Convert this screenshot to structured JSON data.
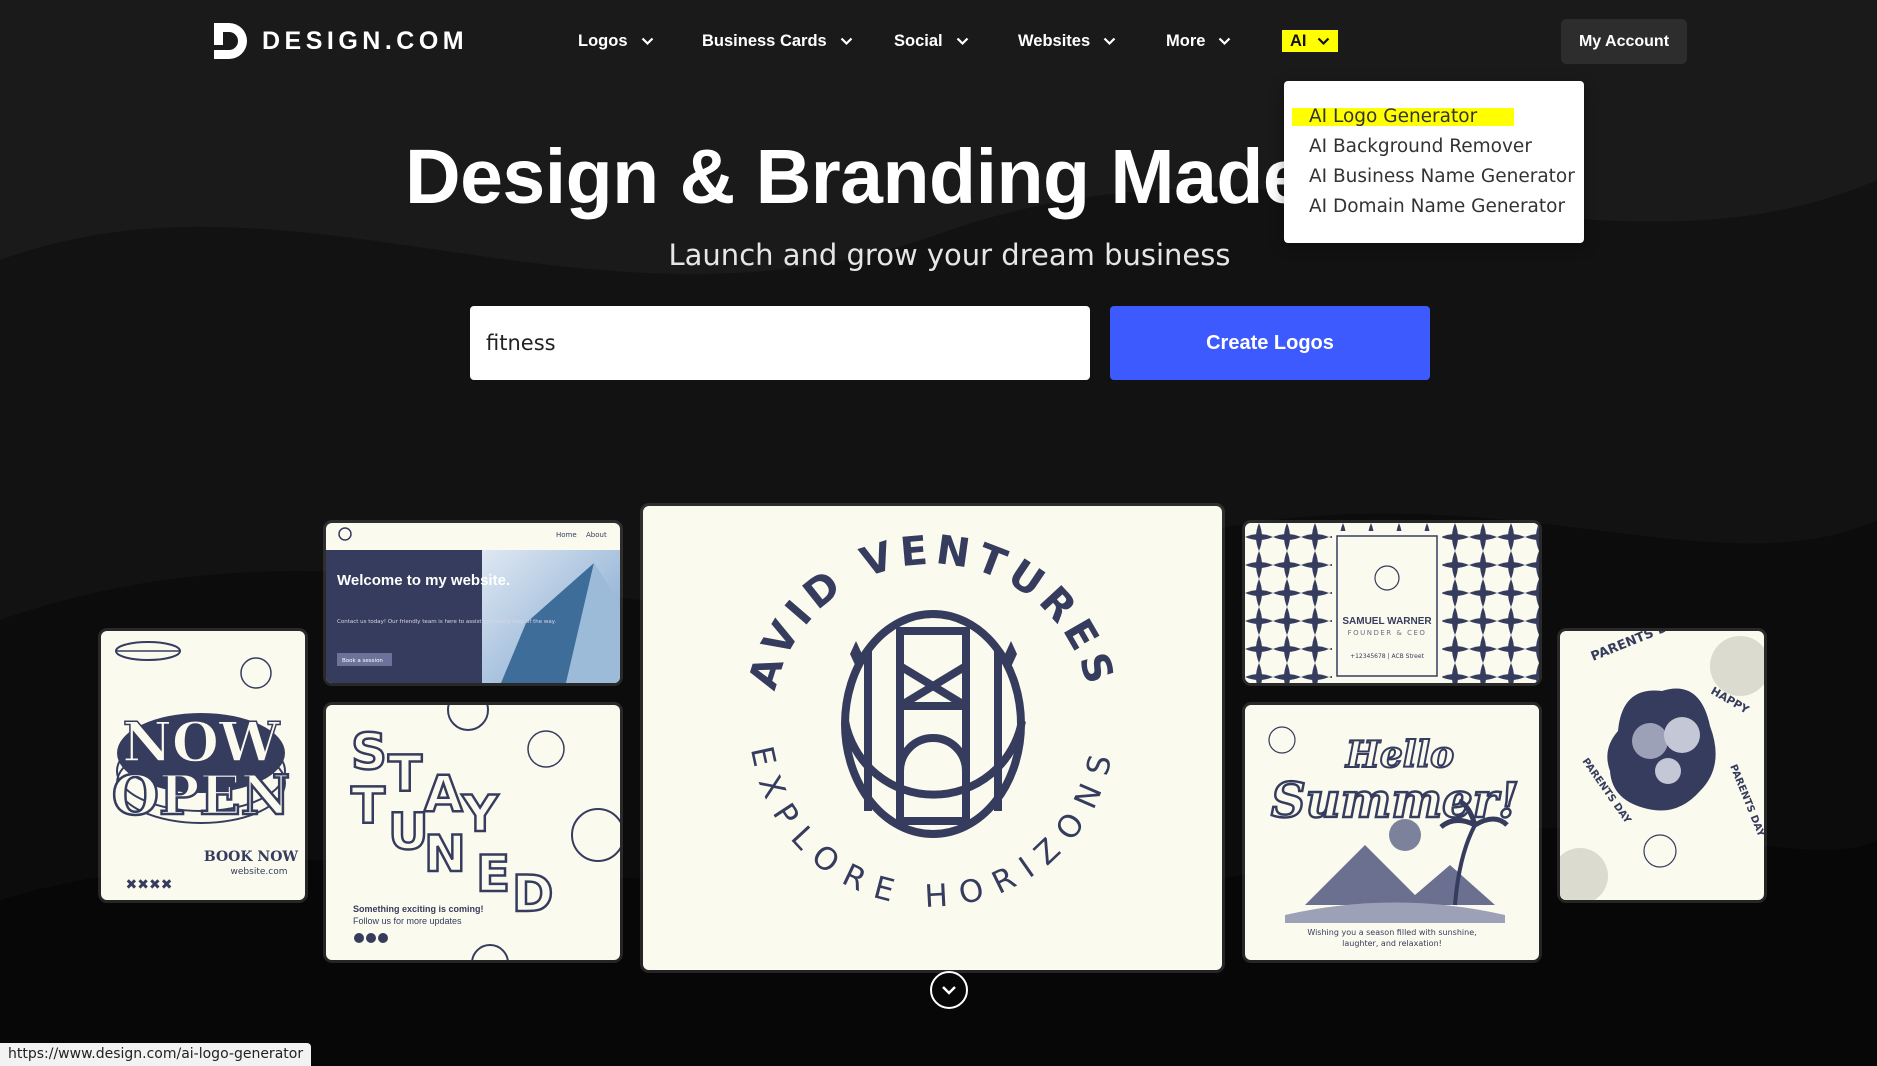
{
  "brand": {
    "name": "DESIGN.COM",
    "accent": "#3d5afe",
    "highlight": "#ffff00"
  },
  "nav": {
    "items": [
      {
        "label": "Logos"
      },
      {
        "label": "Business Cards"
      },
      {
        "label": "Social"
      },
      {
        "label": "Websites"
      },
      {
        "label": "More"
      },
      {
        "label": "AI"
      }
    ],
    "account_label": "My Account"
  },
  "ai_dropdown": {
    "items": [
      {
        "label": "AI Logo Generator"
      },
      {
        "label": "AI Background Remover"
      },
      {
        "label": "AI Business Name Generator"
      },
      {
        "label": "AI Domain Name Generator"
      }
    ]
  },
  "hero": {
    "title": "Design & Branding Made",
    "subtitle": "Launch and grow your dream business",
    "search_value": "fitness",
    "button_label": "Create Logos"
  },
  "cards": {
    "website": {
      "nav_home": "Home",
      "nav_about": "About",
      "headline": "Welcome to my website.",
      "body": "Contact us today! Our friendly team is here to assist you every step of the way.",
      "button": "Book a session"
    },
    "now_open": {
      "line1": "NOW",
      "line2": "OPEN",
      "book": "BOOK NOW",
      "site": "website.com",
      "stars": "✖✖✖✖"
    },
    "stay_tuned": {
      "letters": [
        "S",
        "T",
        "A",
        "Y",
        "T",
        "U",
        "N",
        "E",
        "D"
      ],
      "line1": "Something exciting is coming!",
      "line2": "Follow us for more updates"
    },
    "logo": {
      "top": "AVID VENTURES",
      "bottom": "EXPLORE HORIZONS"
    },
    "business_card": {
      "name": "SAMUEL WARNER",
      "title": "FOUNDER & CEO",
      "contact": "+12345678 | ACB Street"
    },
    "summer": {
      "line1": "Hello",
      "line2": "Summer!",
      "caption1": "Wishing you a season filled with sunshine,",
      "caption2": "laughter, and relaxation!"
    },
    "parents_day": {
      "ring": "PARENTS DAY",
      "happy": "HAPPY",
      "pd_left": "PARENTS DAY",
      "pd_right": "PARENTS DAY"
    }
  },
  "status_bar": {
    "url": "https://www.design.com/ai-logo-generator"
  }
}
